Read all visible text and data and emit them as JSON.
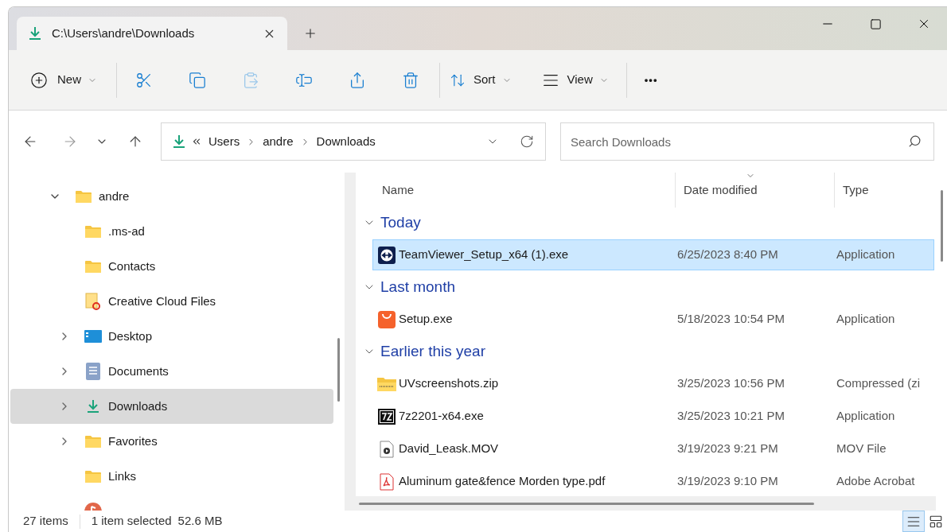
{
  "tab": {
    "title": "C:\\Users\\andre\\Downloads",
    "selected": true
  },
  "toolbar": {
    "new_label": "New",
    "icon_buttons": [
      {
        "disabled": false
      },
      {
        "disabled": false
      },
      {
        "disabled": true
      },
      {
        "disabled": false
      },
      {
        "disabled": false
      },
      {
        "disabled": false
      }
    ],
    "sort_label": "Sort",
    "view_label": "View",
    "more_label": "•••"
  },
  "address": {
    "crumbs": [
      "Users",
      "andre",
      "Downloads"
    ]
  },
  "search": {
    "placeholder": "Search Downloads"
  },
  "nav_tree": [
    {
      "label": "andre",
      "kind": "folder",
      "expandable": true,
      "expanded": true,
      "selected": false,
      "children": [
        {
          "label": ".ms-ad",
          "kind": "folder",
          "expandable": false,
          "expanded": false,
          "selected": false
        },
        {
          "label": "Contacts",
          "kind": "folder",
          "expandable": false,
          "expanded": false,
          "selected": false
        },
        {
          "label": "Creative Cloud Files",
          "kind": "cloud",
          "expandable": false,
          "expanded": false,
          "selected": false
        },
        {
          "label": "Desktop",
          "kind": "desktop",
          "expandable": true,
          "expanded": false,
          "selected": false
        },
        {
          "label": "Documents",
          "kind": "documents",
          "expandable": true,
          "expanded": false,
          "selected": false
        },
        {
          "label": "Downloads",
          "kind": "downloads",
          "expandable": true,
          "expanded": false,
          "selected": true
        },
        {
          "label": "Favorites",
          "kind": "folder",
          "expandable": true,
          "expanded": false,
          "selected": false
        },
        {
          "label": "Links",
          "kind": "folder",
          "expandable": false,
          "expanded": false,
          "selected": false
        },
        {
          "kind": "music",
          "expandable": false,
          "expanded": false,
          "selected": false
        }
      ]
    }
  ],
  "columns": [
    "Name",
    "Date modified",
    "Type"
  ],
  "groups": [
    {
      "title": "Today",
      "expanded": true,
      "files": [
        {
          "name": "TeamViewer_Setup_x64 (1).exe",
          "date": "6/25/2023 8:40 PM",
          "type": "Application",
          "kind": "teamviewer",
          "selected": true
        }
      ]
    },
    {
      "title": "Last month",
      "expanded": true,
      "files": [
        {
          "name": "Setup.exe",
          "date": "5/18/2023 10:54 PM",
          "type": "Application",
          "kind": "bag",
          "selected": false
        }
      ]
    },
    {
      "title": "Earlier this year",
      "expanded": true,
      "files": [
        {
          "name": "UVscreenshots.zip",
          "date": "3/25/2023 10:56 PM",
          "type": "Compressed (zi",
          "kind": "zip",
          "selected": false
        },
        {
          "name": "7z2201-x64.exe",
          "date": "3/25/2023 10:21 PM",
          "type": "Application",
          "kind": "sevenzip",
          "selected": false
        },
        {
          "name": "David_Leask.MOV",
          "date": "3/19/2023 9:21 PM",
          "type": "MOV File",
          "kind": "video",
          "selected": false
        },
        {
          "name": "Aluminum gate&fence Morden type.pdf",
          "date": "3/19/2023 9:10 PM",
          "type": "Adobe Acrobat",
          "kind": "pdf",
          "selected": false
        }
      ]
    }
  ],
  "status": {
    "items": "27 items",
    "selection": "1 item selected",
    "size": "52.6 MB"
  },
  "view_buttons": [
    {
      "selected": true
    },
    {
      "selected": false
    }
  ]
}
